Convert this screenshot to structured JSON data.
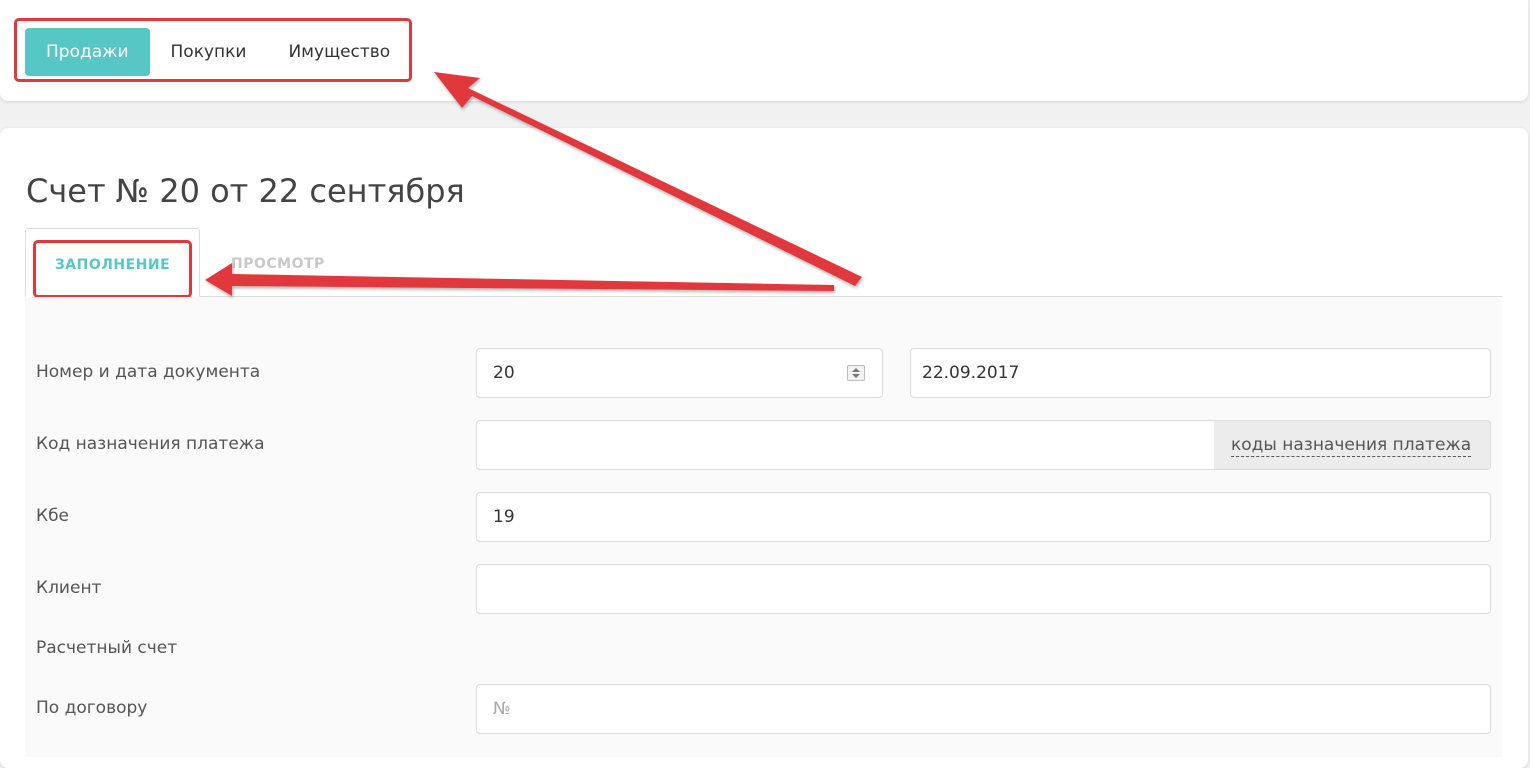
{
  "top_nav": {
    "items": [
      {
        "label": "Продажи",
        "active": true
      },
      {
        "label": "Покупки",
        "active": false
      },
      {
        "label": "Имущество",
        "active": false
      }
    ]
  },
  "document": {
    "title": "Счет № 20 от 22 сентября",
    "tabs": [
      {
        "label": "ЗАПОЛНЕНИЕ",
        "active": true
      },
      {
        "label": "ПРОСМОТР",
        "active": false
      }
    ]
  },
  "form": {
    "number_date": {
      "label": "Номер и дата документа",
      "number": "20",
      "date": "22.09.2017"
    },
    "payment_code": {
      "label": "Код назначения платежа",
      "value": "",
      "addon_link": "коды назначения платежа"
    },
    "kbe": {
      "label": "Кбе",
      "value": "19"
    },
    "client": {
      "label": "Клиент",
      "value": ""
    },
    "account": {
      "label": "Расчетный счет"
    },
    "contract": {
      "label": "По договору",
      "placeholder": "№"
    }
  },
  "colors": {
    "accent": "#56c7c5",
    "annotation": "#e0393c",
    "page_bg": "#f1f1f1"
  }
}
